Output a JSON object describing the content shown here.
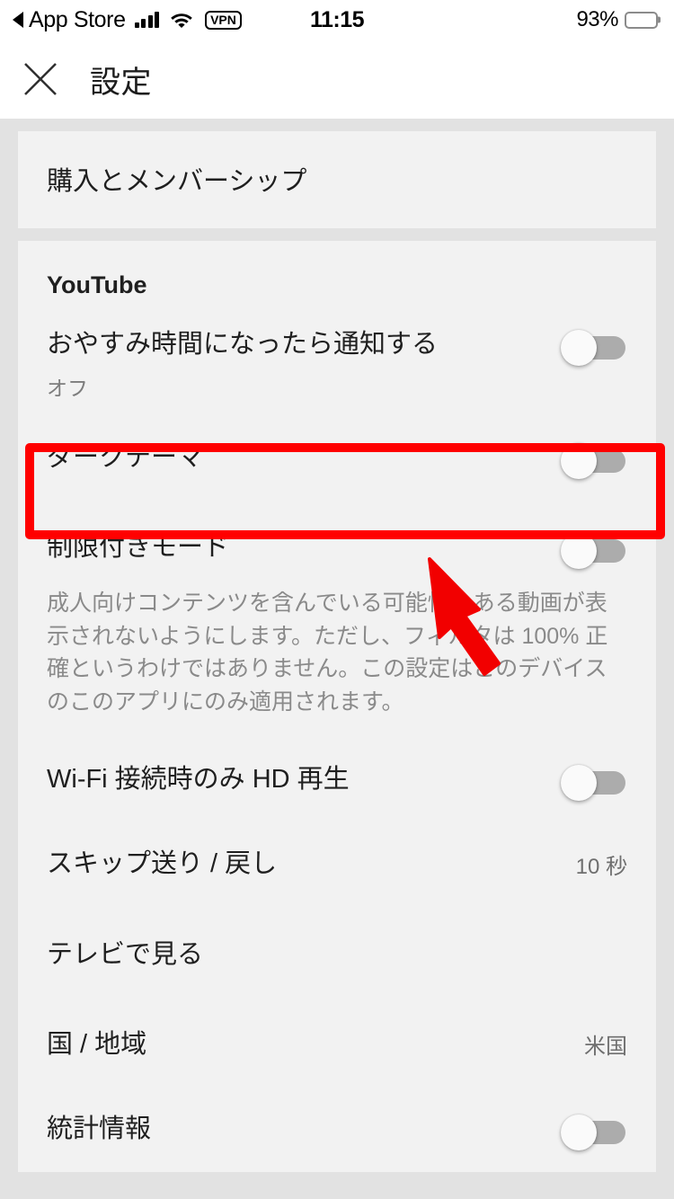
{
  "status_bar": {
    "back_app": "App Store",
    "back_icon": "back-triangle-icon",
    "signal_icon": "cellular-signal-icon",
    "wifi_icon": "wifi-icon",
    "vpn_badge": "VPN",
    "time": "11:15",
    "battery_percent": "93%",
    "battery_icon": "battery-icon"
  },
  "header": {
    "close_icon": "close-icon",
    "title": "設定"
  },
  "cards": {
    "purchases": {
      "label": "購入とメンバーシップ"
    },
    "youtube": {
      "section_title": "YouTube",
      "rows": [
        {
          "label": "おやすみ時間になったら通知する",
          "sub": "オフ",
          "toggle": "off"
        },
        {
          "label": "ダークテーマ",
          "toggle": "off"
        },
        {
          "label": "制限付きモード",
          "toggle": "off"
        }
      ],
      "restricted_description": "成人向けコンテンツを含んでいる可能性のある動画が表示されないようにします。ただし、フィルタは 100% 正確というわけではありません。この設定はこのデバイスのこのアプリにのみ適用されます。",
      "hd_row": {
        "label": "Wi-Fi 接続時のみ HD 再生",
        "toggle": "off"
      },
      "skip_row": {
        "label": "スキップ送り / 戻し",
        "value": "10 秒"
      },
      "tv_row": {
        "label": "テレビで見る"
      },
      "country_row": {
        "label": "国 / 地域",
        "value": "米国"
      },
      "stats_row": {
        "label": "統計情報",
        "toggle": "off"
      }
    }
  },
  "annotation": {
    "highlight_color": "#ff0000",
    "arrow_color": "#ff0000",
    "target": "ダークテーマ"
  },
  "colors": {
    "page_bg": "#e2e2e2",
    "card_bg": "#f2f2f2",
    "chrome_bg": "#ffffff",
    "text_primary": "#1f1f1f",
    "text_secondary": "#8a8a8a",
    "toggle_track_off": "#acacac",
    "toggle_thumb": "#fafafa",
    "annotation": "#ff0000"
  }
}
